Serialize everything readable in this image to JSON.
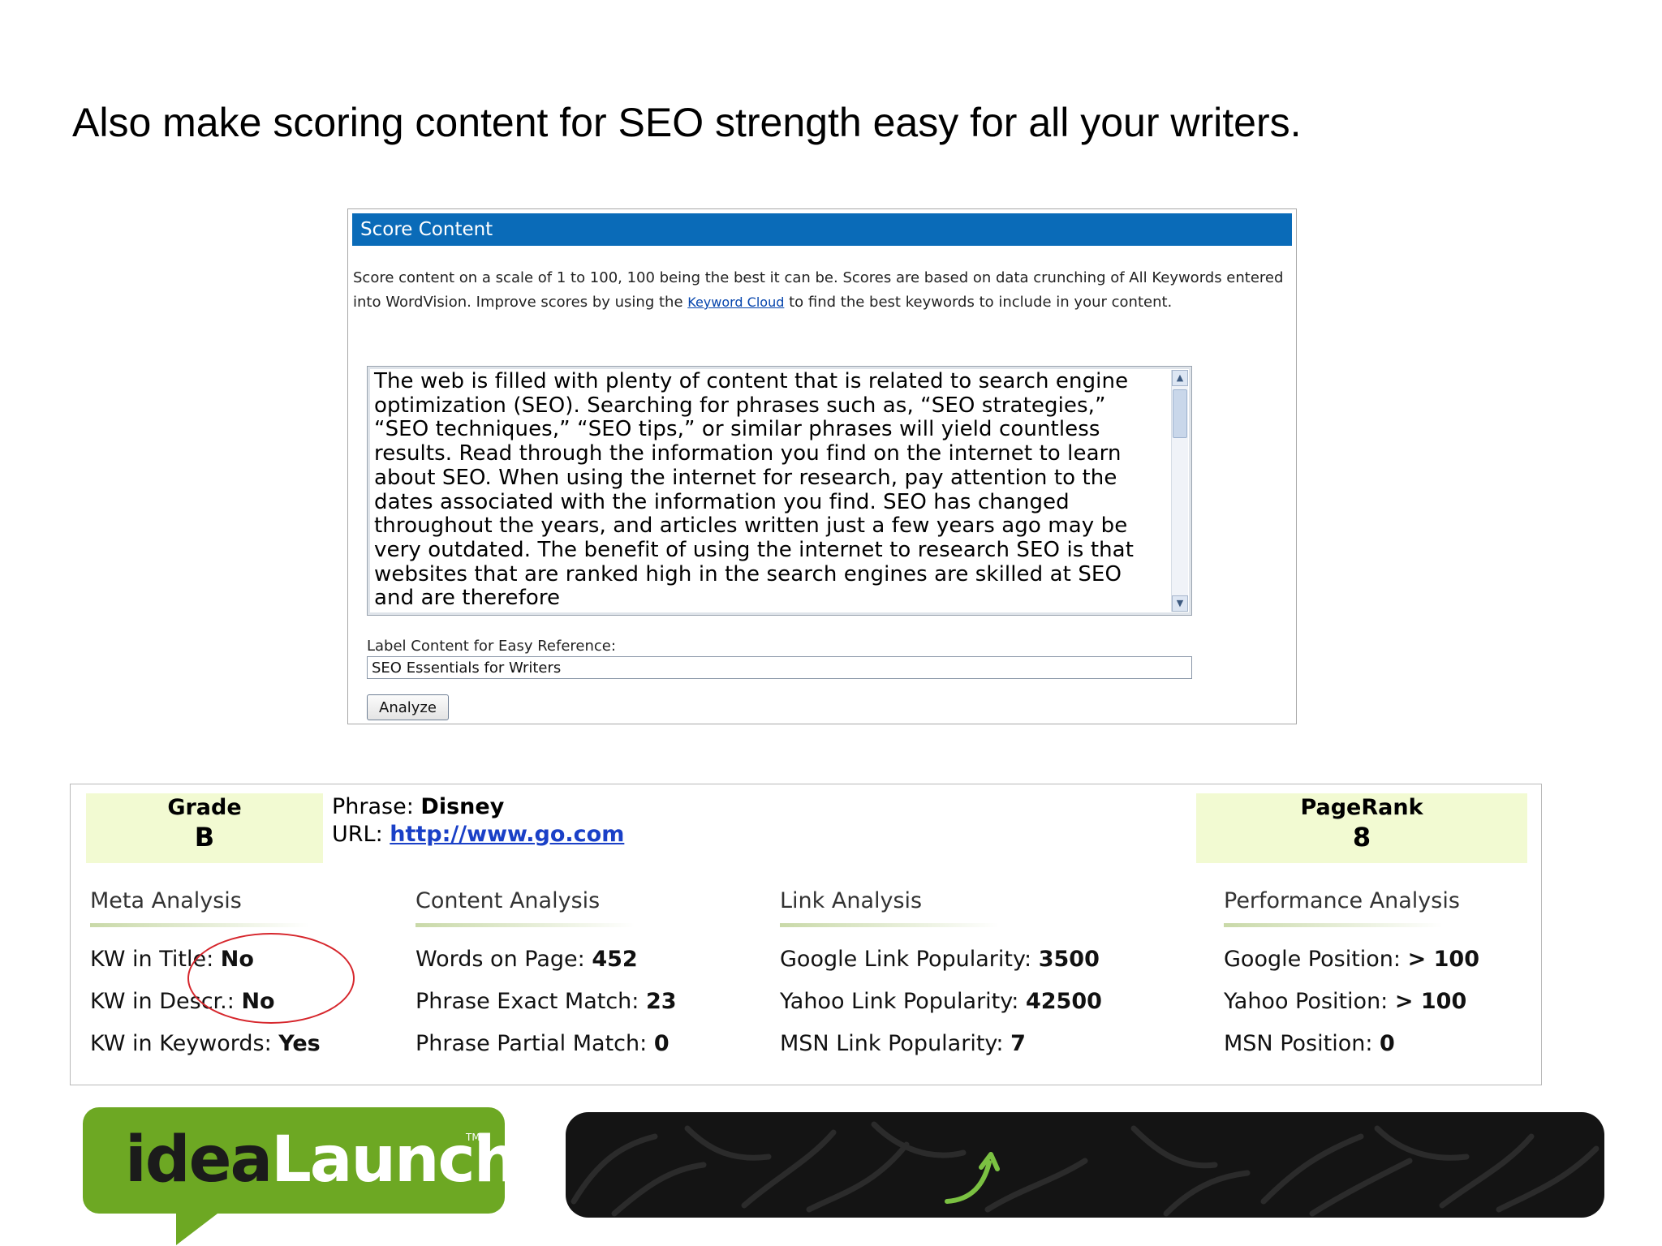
{
  "slide": {
    "title": "Also make scoring content for SEO strength easy for all your writers."
  },
  "score_content": {
    "header": "Score Content",
    "description_part1": "Score content on a scale of 1 to 100, 100 being the best it can be. Scores are based on data crunching of All Keywords entered into WordVision. Improve scores by using the",
    "keyword_cloud_link": "Keyword Cloud",
    "description_part2": "to find the best keywords to include in your content.",
    "content_text": "The web is filled with plenty of content that is related to search engine optimization (SEO). Searching for phrases such as, “SEO strategies,” “SEO techniques,” “SEO tips,” or similar phrases will yield countless results. Read through the information you find on the internet to learn about SEO. When using the internet for research, pay attention to the dates associated with the information you find. SEO has changed throughout the years, and articles written just a few years ago may be very outdated. The benefit of using the internet to research SEO is that websites that are ranked high in the search engines are skilled at SEO and are therefore",
    "label_caption": "Label Content for Easy Reference:",
    "label_value": "SEO Essentials for Writers",
    "analyze_label": "Analyze"
  },
  "results": {
    "grade_label": "Grade",
    "grade_value": "B",
    "phrase_label": "Phrase:",
    "phrase_value": "Disney",
    "url_label": "URL:",
    "url_value": "http://www.go.com",
    "pagerank_label": "PageRank",
    "pagerank_value": "8",
    "meta": {
      "title": "Meta Analysis",
      "items": [
        {
          "label": "KW in Title:",
          "value": "No"
        },
        {
          "label": "KW in Descr.:",
          "value": "No"
        },
        {
          "label": "KW in Keywords:",
          "value": "Yes"
        }
      ]
    },
    "content": {
      "title": "Content Analysis",
      "items": [
        {
          "label": "Words on Page:",
          "value": "452"
        },
        {
          "label": "Phrase Exact Match:",
          "value": "23"
        },
        {
          "label": "Phrase Partial Match:",
          "value": "0"
        }
      ]
    },
    "link": {
      "title": "Link Analysis",
      "items": [
        {
          "label": "Google Link Popularity:",
          "value": "3500"
        },
        {
          "label": "Yahoo Link Popularity:",
          "value": "42500"
        },
        {
          "label": "MSN Link Popularity:",
          "value": "7"
        }
      ]
    },
    "performance": {
      "title": "Performance Analysis",
      "items": [
        {
          "label": "Google Position:",
          "value": "> 100"
        },
        {
          "label": "Yahoo Position:",
          "value": "> 100"
        },
        {
          "label": "MSN Position:",
          "value": "0"
        }
      ]
    }
  },
  "brand": {
    "logo_part1": "idea",
    "logo_part2": "Launch",
    "logo_tm": "TM"
  },
  "colors": {
    "header_blue": "#0a6bb8",
    "link_blue": "#1a40c7",
    "highlight_green": "#f2fad2",
    "brand_green": "#6da823",
    "annotation_red": "#d6262c"
  }
}
